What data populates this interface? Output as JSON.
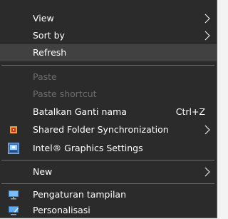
{
  "menu": {
    "items": [
      {
        "label": "View",
        "submenu": true
      },
      {
        "label": "Sort by",
        "submenu": true
      },
      {
        "label": "Refresh",
        "highlighted": true
      },
      {
        "label": "Paste",
        "disabled": true
      },
      {
        "label": "Paste shortcut",
        "disabled": true
      },
      {
        "label": "Batalkan Ganti nama",
        "shortcut": "Ctrl+Z"
      },
      {
        "label": "Shared Folder Synchronization",
        "icon": "shared-folder-sync-icon",
        "submenu": true
      },
      {
        "label": "Intel® Graphics Settings",
        "icon": "intel-graphics-icon"
      },
      {
        "label": "New",
        "submenu": true
      },
      {
        "label": "Pengaturan tampilan",
        "icon": "display-settings-icon"
      },
      {
        "label": "Personalisasi",
        "icon": "personalization-icon"
      }
    ]
  },
  "colors": {
    "menu_background": "#2b2b2b",
    "highlight": "#414141",
    "separator": "#6a6a6a",
    "disabled_text": "#6d6d6d",
    "text": "#ffffff"
  }
}
